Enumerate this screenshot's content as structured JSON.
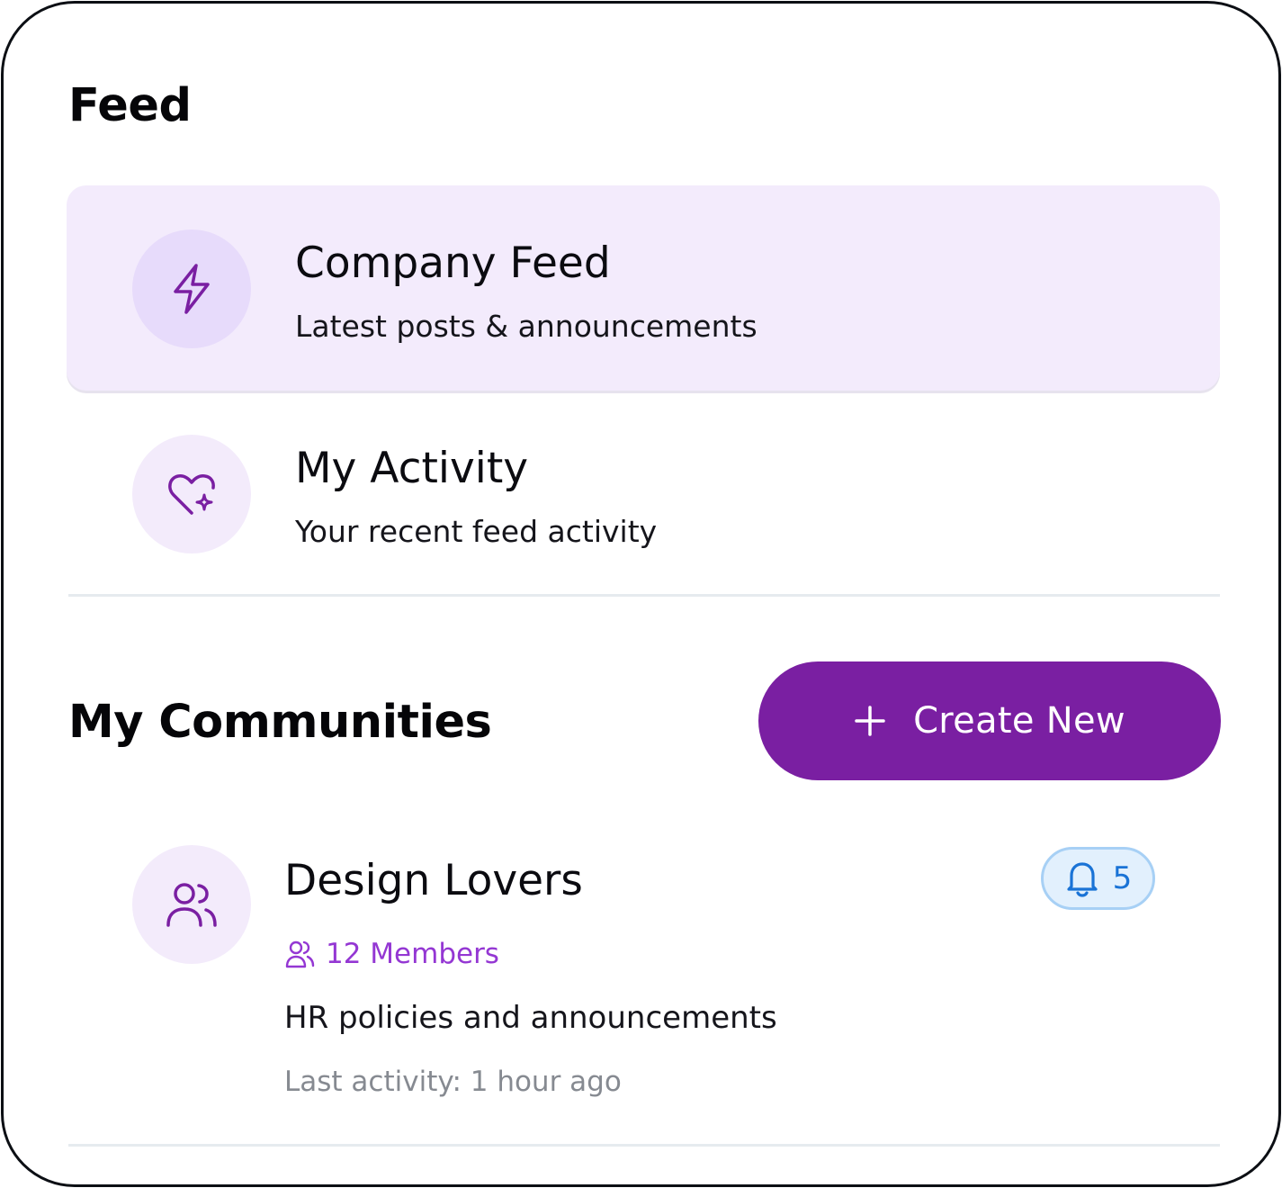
{
  "feed": {
    "title": "Feed",
    "items": [
      {
        "title": "Company Feed",
        "subtitle": "Latest posts & announcements",
        "icon": "lightning-icon",
        "active": true
      },
      {
        "title": "My Activity",
        "subtitle": "Your recent feed activity",
        "icon": "heart-sparkle-icon",
        "active": false
      }
    ]
  },
  "communities": {
    "title": "My Communities",
    "create_label": "Create New",
    "items": [
      {
        "name": "Design Lovers",
        "members": "12 Members",
        "description": "HR policies and announcements",
        "last_activity": "Last activity: 1 hour ago",
        "notifications": "5",
        "icon": "users-icon"
      }
    ]
  },
  "colors": {
    "accent": "#7a1fa2",
    "active_bg": "#f3ebfc",
    "member_text": "#9437d3",
    "badge_blue": "#1a73d6"
  }
}
